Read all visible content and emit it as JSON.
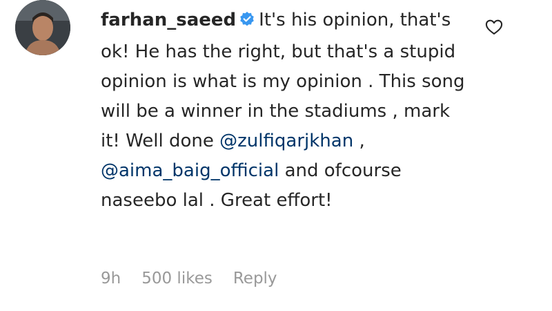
{
  "comment": {
    "username": "farhan_saeed",
    "verified": true,
    "text_segments": {
      "t1": "It's his opinion, that's ok! He has the right, but that's a stupid opinion is what is my opinion . This song will be a winner in the stadiums , mark it! Well done ",
      "m1": "@zulfiqarjkhan",
      "t2": " , ",
      "m2": "@aima_baig_official",
      "t3": " and ofcourse naseebo lal . Great effort!"
    },
    "time": "9h",
    "likes": "500 likes",
    "reply_label": "Reply"
  },
  "colors": {
    "text": "#262626",
    "mention": "#003569",
    "meta": "#999999",
    "verified_badge": "#3897f0"
  },
  "icons": {
    "verified": "verified-badge-icon",
    "like": "heart-outline-icon"
  }
}
